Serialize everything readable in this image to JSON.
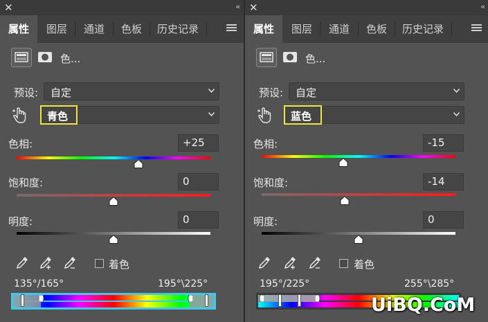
{
  "panels": [
    {
      "tabs": [
        "属性",
        "图层",
        "通道",
        "色板",
        "历史记录"
      ],
      "mode_label": "色...",
      "preset_label": "预设:",
      "preset_value": "自定",
      "channel_value": "青色",
      "hue_label": "色相:",
      "hue_value": "+25",
      "hue_pos": 0.63,
      "saturation_label": "饱和度:",
      "saturation_value": "0",
      "saturation_pos": 0.5,
      "lightness_label": "明度:",
      "lightness_value": "0",
      "lightness_pos": 0.5,
      "colorize_label": "着色",
      "range_left": "135°/165°",
      "range_right": "195°\\225°"
    },
    {
      "tabs": [
        "属性",
        "图层",
        "通道",
        "色板",
        "历史记录"
      ],
      "mode_label": "色...",
      "preset_label": "预设:",
      "preset_value": "自定",
      "channel_value": "蓝色",
      "hue_label": "色相:",
      "hue_value": "-15",
      "hue_pos": 0.42,
      "saturation_label": "饱和度:",
      "saturation_value": "-14",
      "saturation_pos": 0.43,
      "lightness_label": "明度:",
      "lightness_value": "0",
      "lightness_pos": 0.5,
      "colorize_label": "着色",
      "range_left": "195°/225°",
      "range_right": "255°\\285°"
    }
  ],
  "watermark": "UiBQ.CoM",
  "icons": [
    "close-icon",
    "collapse-icon",
    "panel-menu-icon",
    "adjustment-icon",
    "mask-icon",
    "hand-target-icon",
    "eyedropper-icon",
    "eyedropper-plus-icon",
    "eyedropper-minus-icon"
  ],
  "colors": {
    "highlight": "#f0e442",
    "panel_bg": "#535353",
    "range_bar": "#3fc8f0"
  }
}
